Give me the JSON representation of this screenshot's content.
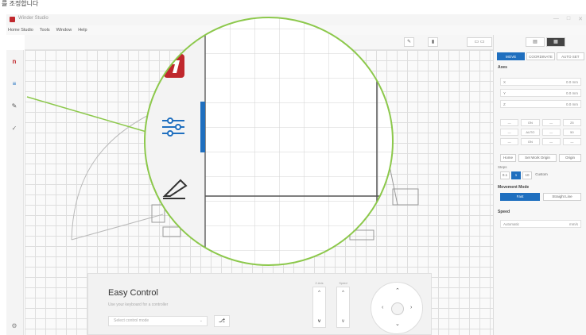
{
  "caption": "를 조정합니다",
  "app": {
    "title": "Winder Studio",
    "window_controls": [
      "—",
      "□",
      "✕"
    ]
  },
  "menu": [
    "Home Studio",
    "Tools",
    "Window",
    "Help"
  ],
  "canvas_toolbar": {
    "buttons": [
      "✎",
      "▮",
      "▭  ▭",
      "▤",
      "▦"
    ]
  },
  "right_panel": {
    "tabs": [
      "MOVE",
      "COORDINATE",
      "AUTO SET"
    ],
    "axes_label": "Axes",
    "fields": [
      {
        "axis": "X",
        "value": "0.0 mm"
      },
      {
        "axis": "Y",
        "value": "0.0 mm"
      },
      {
        "axis": "Z",
        "value": "0.0 mm"
      }
    ],
    "step_grid": [
      "—",
      "ON",
      "—",
      "25",
      "—",
      "AUTO",
      "—",
      "50",
      "—",
      "ON",
      "—",
      "—"
    ],
    "home_buttons": [
      "Home",
      "Set Work Origin",
      "Origin"
    ],
    "steps_label": "Steps",
    "steps": [
      "0.1",
      "1",
      "10",
      "Custom"
    ],
    "movement_label": "Movement Mode",
    "movement": [
      "Fast",
      "Straight Line"
    ],
    "speed_label": "Speed",
    "speed_value": "Automatic",
    "speed_unit": "mm/s"
  },
  "easy_control": {
    "title": "Easy Control",
    "subtitle": "Use your keyboard for a controller",
    "select_placeholder": "Select control mode",
    "select_arrow": "⌄",
    "icon_button": "⎇",
    "slider_z_label": "Z-Axis",
    "slider_speed_label": "Speed",
    "slider_up": "^",
    "slider_down": "v"
  },
  "zoom": {
    "logo_letter": "n",
    "colors": {
      "accent": "#1f6fbf",
      "brand": "#c0282d",
      "lens_ring": "#8cc84b"
    }
  }
}
